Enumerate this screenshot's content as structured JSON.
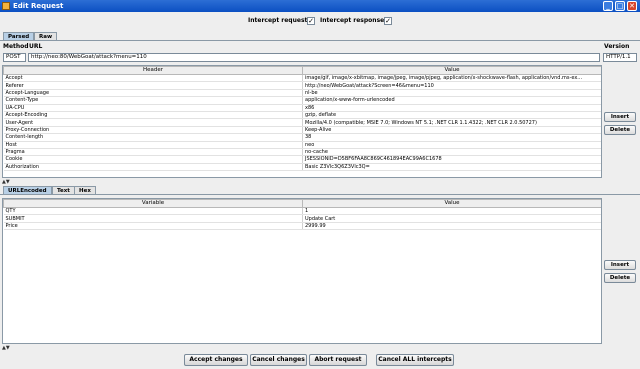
{
  "window": {
    "title": "Edit Request",
    "minimize": "_",
    "maximize": "□",
    "close": "✕"
  },
  "intercept": {
    "requests_label": "Intercept requests :",
    "requests_checked": true,
    "responses_label": "Intercept responses :",
    "responses_checked": true,
    "check_glyph": "✓"
  },
  "top_tabs": [
    {
      "label": "Parsed",
      "active": true
    },
    {
      "label": "Raw",
      "active": false
    }
  ],
  "request_line": {
    "method_label": "Method",
    "url_label": "URL",
    "version_label": "Version",
    "method": "POST",
    "url": "http://neo:80/WebGoat/attack?menu=110",
    "version": "HTTP/1.1"
  },
  "headers_table": {
    "columns": [
      "Header",
      "Value"
    ],
    "rows": [
      [
        "Accept",
        "image/gif, image/x-xbitmap, image/jpeg, image/pjpeg, application/x-shockwave-flash, application/vnd.ms-ex..."
      ],
      [
        "Referer",
        "http://neo/WebGoat/attack?Screen=46&menu=110"
      ],
      [
        "Accept-Language",
        "nl-be"
      ],
      [
        "Content-Type",
        "application/x-www-form-urlencoded"
      ],
      [
        "UA-CPU",
        "x86"
      ],
      [
        "Accept-Encoding",
        "gzip, deflate"
      ],
      [
        "User-Agent",
        "Mozilla/4.0 (compatible; MSIE 7.0; Windows NT 5.1; .NET CLR 1.1.4322; .NET CLR 2.0.50727)"
      ],
      [
        "Proxy-Connection",
        "Keep-Alive"
      ],
      [
        "Content-length",
        "38"
      ],
      [
        "Host",
        "neo"
      ],
      [
        "Pragma",
        "no-cache"
      ],
      [
        "Cookie",
        "JSESSIONID=D5BF6FAA8C869C461894EAC99A6C1678"
      ],
      [
        "Authorization",
        "Basic Z3Vlc3Q6Z3Vlc3Q="
      ]
    ]
  },
  "header_buttons": {
    "insert": "Insert",
    "delete": "Delete"
  },
  "divider_glyph": "▲▼",
  "body_tabs": [
    {
      "label": "URLEncoded",
      "active": true
    },
    {
      "label": "Text",
      "active": false
    },
    {
      "label": "Hex",
      "active": false
    }
  ],
  "params_table": {
    "columns": [
      "Variable",
      "Value"
    ],
    "rows": [
      [
        "QTY",
        "1"
      ],
      [
        "SUBMIT",
        "Update Cart"
      ],
      [
        "Price",
        "2999.99"
      ]
    ]
  },
  "param_buttons": {
    "insert": "Insert",
    "delete": "Delete"
  },
  "footer_buttons": {
    "accept": "Accept changes",
    "cancel": "Cancel changes",
    "abort": "Abort request",
    "cancel_all": "Cancel ALL intercepts"
  }
}
